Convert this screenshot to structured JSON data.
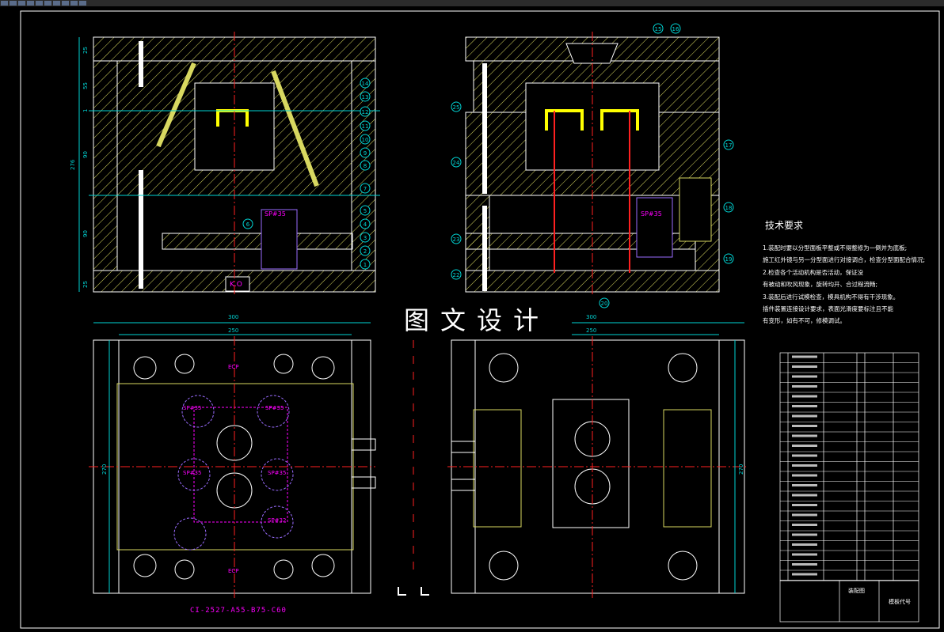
{
  "watermark": "图文设计",
  "technical_requirements": {
    "title": "技术要求",
    "lines": [
      "1.装配时要以分型面板平整或不得整修为一倒并为底板;",
      "施工红外镜与另一分型面进行对接调合，检查分型面配合情况;",
      "2.检查各个活动机构是否活动，保证没",
      "有被动和吹风现象，旋转均开、合过程流畅;",
      "3.装配后进行试模检查，模具机构不得有干涉现象。",
      "插件装置连接设计要求，表面光滑度要标注且不能",
      "有变形，如有不可，修模调试。"
    ]
  },
  "mold_designation": "CI-2527-A55-B75-C60",
  "labels": {
    "sp_top_left": "SP#35",
    "sp_top_right": "SP#35",
    "ko": "K.O",
    "sp_bl_1": "SP#35",
    "sp_bl_2": "SP#35",
    "sp_bl_3": "SP#35",
    "sp_bl_4": "SP#32",
    "sp_bl_5": "SP#35",
    "ec_1": "ECP",
    "ec_2": "ECP"
  },
  "dimensions": {
    "d25_top": "25",
    "d55": "55",
    "d1": "1",
    "d90_a": "90",
    "d276": "276",
    "d90_b": "90",
    "d25_bottom": "25",
    "d300_left": "300",
    "d250_left": "250",
    "d270_left": "270",
    "d300_right": "300",
    "d250_right": "250",
    "d270_right": "270"
  },
  "balloons_left": [
    "14",
    "13",
    "12",
    "11",
    "10",
    "9",
    "8",
    "7",
    "6",
    "5",
    "4",
    "3",
    "2",
    "1"
  ],
  "balloons_right": [
    "15",
    "16",
    "25",
    "24",
    "17",
    "18",
    "23",
    "22",
    "19",
    "20"
  ],
  "title_block": {
    "cell_a": "装配图",
    "cell_b": "模板代号"
  },
  "colors": {
    "background": "#000000",
    "outline": "#ffffff",
    "hatch": "#d8d860",
    "dimension": "#00d4d4",
    "center_line": "#ff2020",
    "annotation": "#ff00ff",
    "cavity": "#ffff00"
  }
}
